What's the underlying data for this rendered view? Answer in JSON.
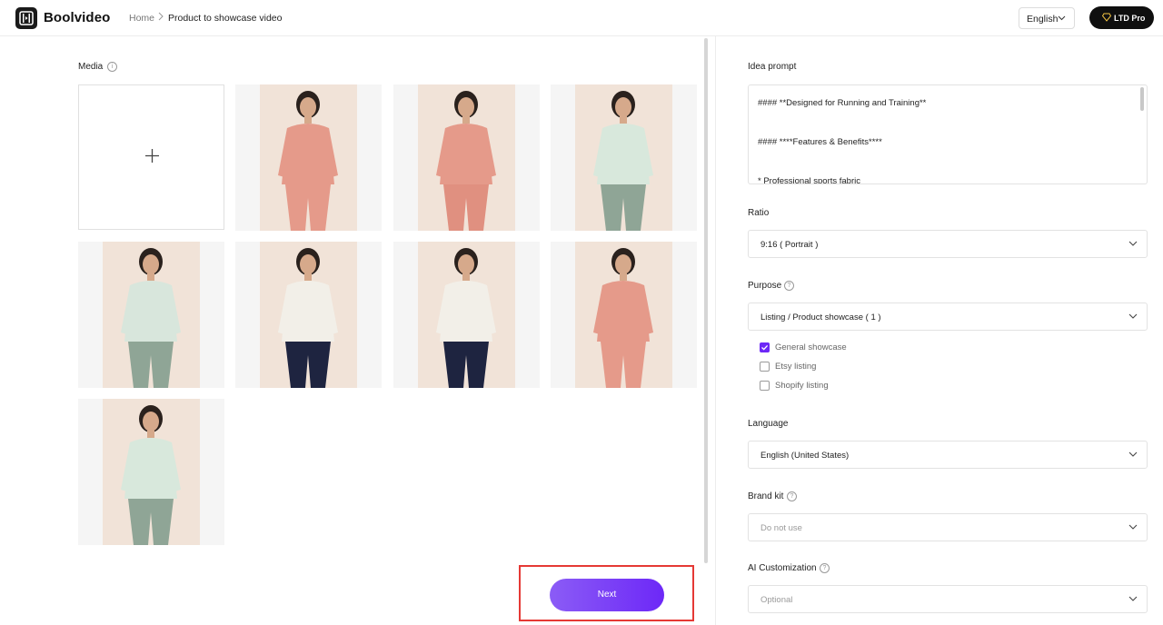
{
  "app": {
    "name": "Boolvideo"
  },
  "breadcrumb": {
    "home": "Home",
    "separator": ">",
    "current": "Product to showcase video"
  },
  "header": {
    "language": "English",
    "plan_label": "LTD Pro"
  },
  "media": {
    "label": "Media",
    "add_icon": "plus-icon",
    "thumbnails": [
      {
        "alt": "Woman in pink long sleeve top, front close-up",
        "shirt": "#e59a8a",
        "pants": "#e59a8a"
      },
      {
        "alt": "Woman in pink top and leggings, full body",
        "shirt": "#e59a8a",
        "pants": "#e09080"
      },
      {
        "alt": "Woman in mint top and green leggings, full body",
        "shirt": "#d8e8dc",
        "pants": "#8fa596"
      },
      {
        "alt": "Back view, mint long sleeve top",
        "shirt": "#d8e6dc",
        "pants": "#8fa596"
      },
      {
        "alt": "Woman in white top and navy skirt",
        "shirt": "#f2efe8",
        "pants": "#1e2440"
      },
      {
        "alt": "Back view, white top and navy skirt",
        "shirt": "#f2efe8",
        "pants": "#1e2440"
      },
      {
        "alt": "Side back view, pink long sleeve top",
        "shirt": "#e59a8a",
        "pants": "#e59a8a"
      },
      {
        "alt": "Woman in mint top, front view",
        "shirt": "#d8e8dc",
        "pants": "#8fa596"
      }
    ]
  },
  "next_button": {
    "label": "Next"
  },
  "idea_prompt": {
    "label": "Idea prompt",
    "lines": [
      "#### **Designed for Running and Training**",
      "#### ****Features & Benefits****",
      "* Professional sports fabric"
    ]
  },
  "ratio": {
    "label": "Ratio",
    "value": "9:16 ( Portrait )"
  },
  "purpose": {
    "label": "Purpose",
    "value": "Listing / Product showcase ( 1 )",
    "options": [
      {
        "label": "General showcase",
        "checked": true
      },
      {
        "label": "Etsy listing",
        "checked": false
      },
      {
        "label": "Shopify listing",
        "checked": false
      }
    ]
  },
  "language": {
    "label": "Language",
    "value": "English (United States)"
  },
  "brand_kit": {
    "label": "Brand kit",
    "placeholder": "Do not use"
  },
  "ai_customization": {
    "label": "AI Customization",
    "placeholder": "Optional"
  },
  "colors": {
    "accent": "#6d28f7",
    "highlight": "#e53935"
  }
}
